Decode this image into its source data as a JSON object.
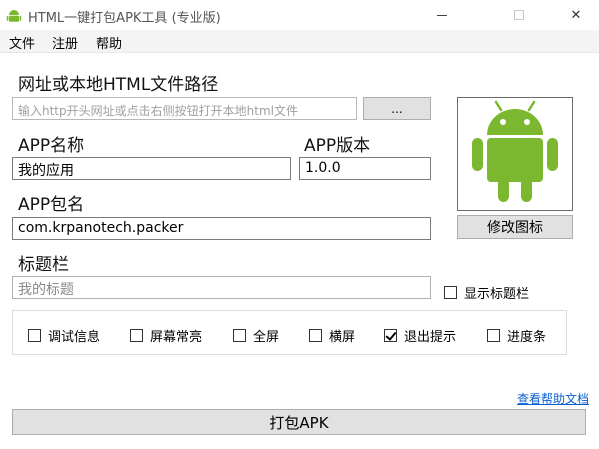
{
  "window": {
    "title": "HTML一键打包APK工具 (专业版)",
    "close_glyph": "✕"
  },
  "menu": [
    "文件",
    "注册",
    "帮助"
  ],
  "url_section": {
    "label": "网址或本地HTML文件路径",
    "placeholder": "输入http开头网址或点击右侧按钮打开本地html文件",
    "browse_label": "..."
  },
  "app_name": {
    "label": "APP名称",
    "value": "我的应用"
  },
  "app_version": {
    "label": "APP版本",
    "value": "1.0.0"
  },
  "package": {
    "label": "APP包名",
    "value": "com.krpanotech.packer"
  },
  "title_bar": {
    "label": "标题栏",
    "placeholder": "我的标题",
    "show_label": "显示标题栏",
    "show_checked": false
  },
  "icon": {
    "change_label": "修改图标",
    "icon_name": "android-robot-icon",
    "color": "#7cb82f"
  },
  "options": [
    {
      "label": "调试信息",
      "checked": false
    },
    {
      "label": "屏幕常亮",
      "checked": false
    },
    {
      "label": "全屏",
      "checked": false
    },
    {
      "label": "横屏",
      "checked": false
    },
    {
      "label": "退出提示",
      "checked": true
    },
    {
      "label": "进度条",
      "checked": false
    }
  ],
  "help_link": "查看帮助文档",
  "build_label": "打包APK"
}
